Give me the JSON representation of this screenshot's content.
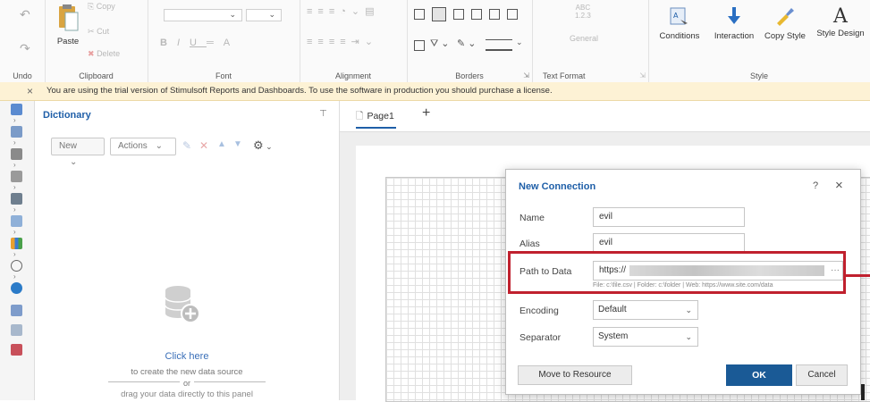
{
  "ribbon": {
    "undo_label": "Undo",
    "clipboard": {
      "paste": "Paste",
      "copy": "Copy",
      "cut": "Cut",
      "delete": "Delete",
      "group": "Clipboard"
    },
    "font_group": "Font",
    "font_bold": "B",
    "font_italic": "I",
    "font_underline": "U",
    "font_color": "A",
    "alignment_group": "Alignment",
    "borders_group": "Borders",
    "text_format": {
      "abc": "ABC",
      "nums": "1.2.3",
      "general": "General",
      "group": "Text Format"
    },
    "style": {
      "conditions": "Conditions",
      "interaction": "Interaction",
      "copy_style": "Copy Style",
      "style_designer": "Style Design",
      "group": "Style"
    }
  },
  "notice": {
    "close": "×",
    "text": "You are using the trial version of Stimulsoft Reports and Dashboards. To use the software in production you should purchase a license."
  },
  "dictionary": {
    "title": "Dictionary",
    "pin": "⊤",
    "new_label": "New",
    "actions_label": "Actions",
    "click_here": "Click here",
    "create_text": "to create the new data source",
    "or_text": "or",
    "drag_text": "drag your data directly to this panel"
  },
  "tabs": {
    "page1": "Page1",
    "add": "+"
  },
  "dialog": {
    "title": "New Connection",
    "help": "?",
    "close": "×",
    "name_label": "Name",
    "name_value": "evil",
    "alias_label": "Alias",
    "alias_value": "evil",
    "path_label": "Path to Data",
    "path_value": "https://",
    "path_browse": "···",
    "path_hint": "File: c:\\file.csv | Folder: c:\\folder | Web: https://www.site.com/data",
    "encoding_label": "Encoding",
    "encoding_value": "Default",
    "separator_label": "Separator",
    "separator_value": "System",
    "move_button": "Move to Resource",
    "ok_button": "OK",
    "cancel_button": "Cancel"
  },
  "colors": {
    "accent": "#1f5fa8",
    "notice_bg": "#fdf2d5",
    "highlight": "#c0202e",
    "ok_bg": "#1a5a96"
  }
}
